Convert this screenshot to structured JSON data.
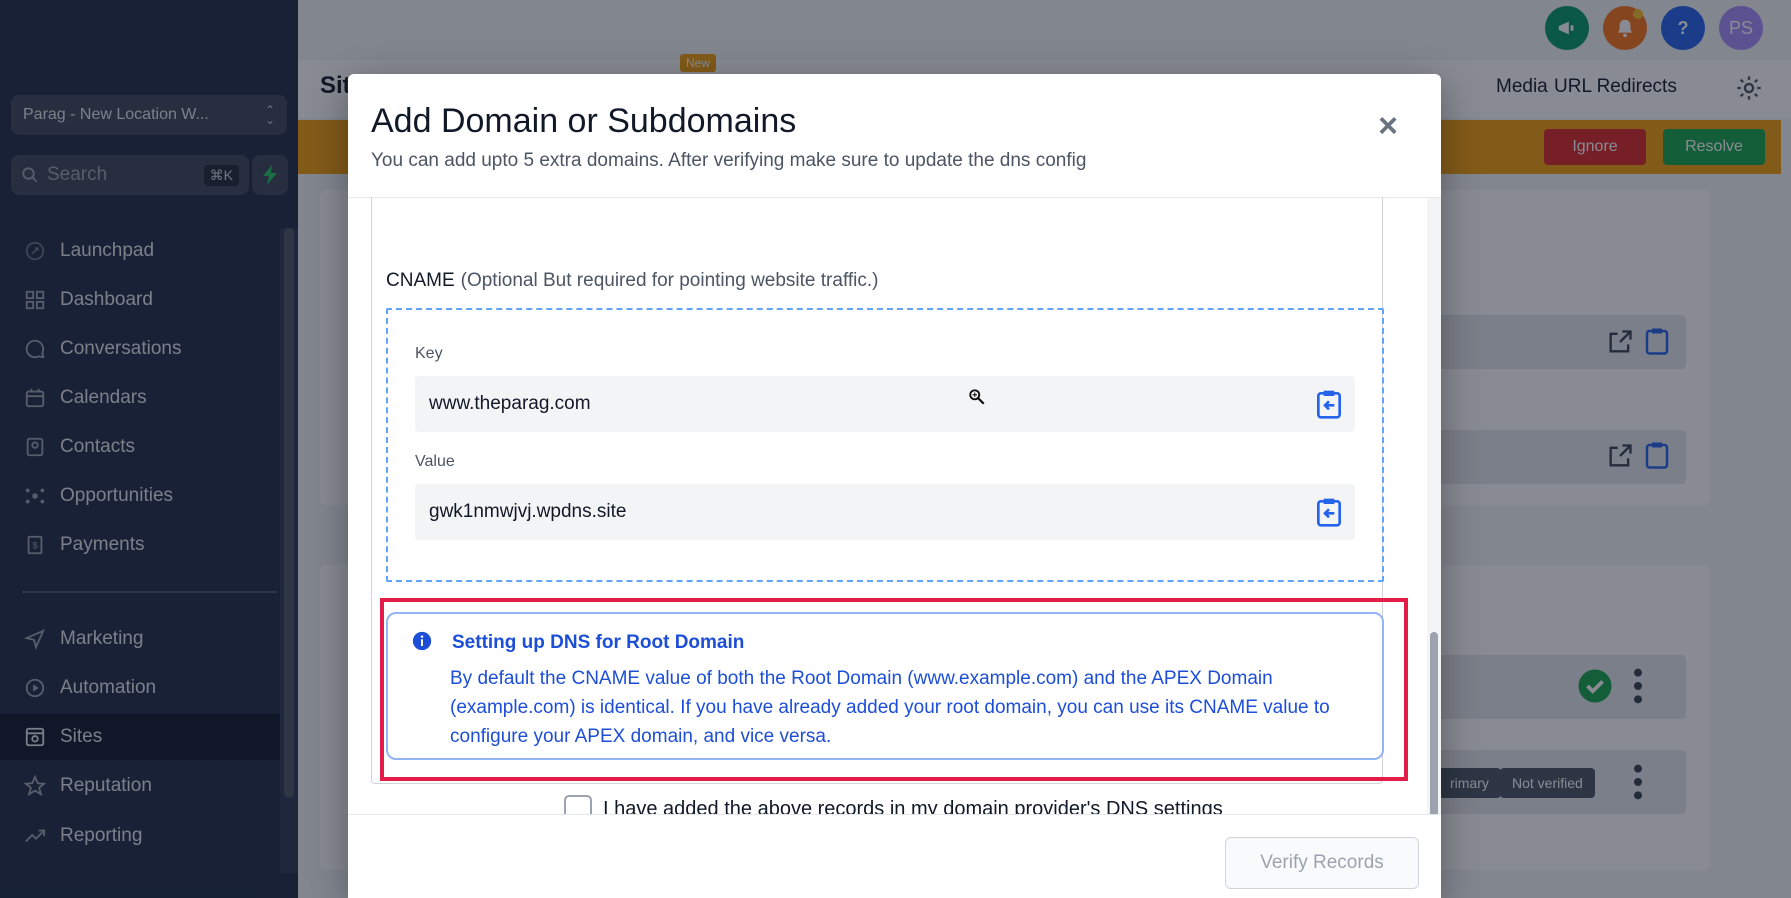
{
  "sidebar": {
    "location": "Parag - New Location W...",
    "search_placeholder": "Search",
    "search_shortcut": "⌘K",
    "items": [
      {
        "label": "Launchpad",
        "icon": "rocket-icon"
      },
      {
        "label": "Dashboard",
        "icon": "grid-icon"
      },
      {
        "label": "Conversations",
        "icon": "chat-icon"
      },
      {
        "label": "Calendars",
        "icon": "calendar-icon"
      },
      {
        "label": "Contacts",
        "icon": "contacts-icon"
      },
      {
        "label": "Opportunities",
        "icon": "opportunities-icon"
      },
      {
        "label": "Payments",
        "icon": "payments-icon"
      },
      {
        "label": "Marketing",
        "icon": "send-icon"
      },
      {
        "label": "Automation",
        "icon": "automation-icon"
      },
      {
        "label": "Sites",
        "icon": "sites-icon",
        "active": true
      },
      {
        "label": "Reputation",
        "icon": "star-icon"
      },
      {
        "label": "Reporting",
        "icon": "trend-icon"
      }
    ]
  },
  "topbar": {
    "avatar_initials": "PS",
    "help_label": "?"
  },
  "header": {
    "title": "Sit",
    "new_badge": "New",
    "tabs": [
      "Media",
      "URL Redirects"
    ]
  },
  "banner": {
    "ignore_label": "Ignore",
    "resolve_label": "Resolve"
  },
  "background_rows": {
    "badge_primary": "rimary",
    "badge_not_verified": "Not verified"
  },
  "modal": {
    "title": "Add Domain or Subdomains",
    "subtitle": "You can add upto 5 extra domains. After verifying make sure to update the dns config",
    "close_label": "×",
    "cname": {
      "label": "CNAME",
      "note": "(Optional But required for pointing website traffic.)",
      "key_label": "Key",
      "key_value": "www.theparag.com",
      "value_label": "Value",
      "value_value": "gwk1nmwjvj.wpdns.site"
    },
    "info": {
      "title": "Setting up DNS for Root Domain",
      "text": "By default the CNAME value of both the Root Domain (www.example.com) and the APEX Domain (example.com) is identical. If you have already added your root domain, you can use its CNAME value to configure your APEX domain, and vice versa."
    },
    "confirm_label": "I have added the above records in my domain provider's DNS settings",
    "verify_label": "Verify Records"
  },
  "colors": {
    "sidebar_bg": "#1e2a44",
    "highlight_red": "#e11d48",
    "info_blue": "#1d4ed8",
    "banner_orange": "#f59e0b",
    "ignore_red": "#dc2626",
    "resolve_green": "#16a34a"
  }
}
